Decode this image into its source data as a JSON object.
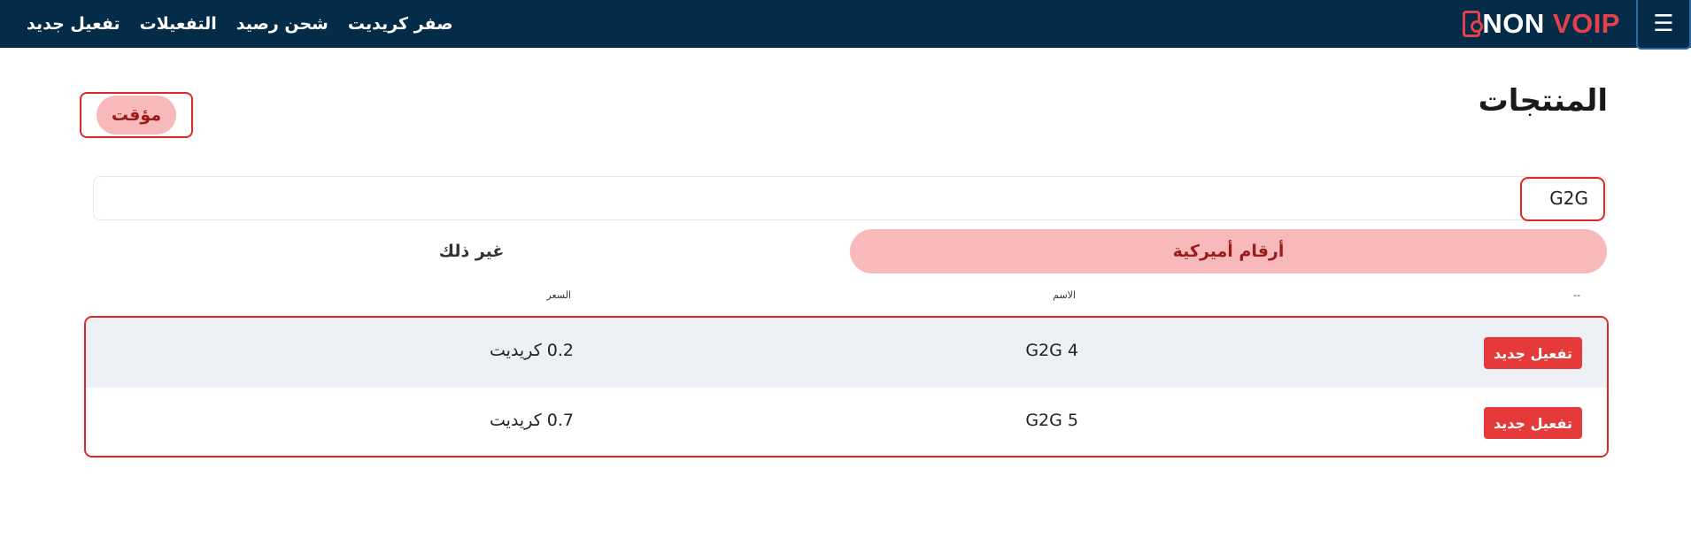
{
  "nav": {
    "links": [
      "تفعيل جديد",
      "التفعيلات",
      "شحن رصيد",
      "صفر كريديت"
    ],
    "logo_part1": "NON",
    "logo_part2": "VOIP",
    "menu_icon": "hamburger-icon",
    "bg_color": "#042b47",
    "accent_color": "#e4424a"
  },
  "header": {
    "title": "المنتجات",
    "timer_label": "مؤقت"
  },
  "search": {
    "value": "G2G",
    "placeholder": ""
  },
  "tabs": [
    {
      "label": "أرقام أميركية",
      "active": true
    },
    {
      "label": "غير ذلك",
      "active": false
    }
  ],
  "table": {
    "columns": [
      "--",
      "الاسم",
      "السعر"
    ],
    "rows": [
      {
        "action": "تفعيل جديد",
        "name": "G2G 4",
        "price": "0.2 كريديت"
      },
      {
        "action": "تفعيل جديد",
        "name": "G2G 5",
        "price": "0.7 كريديت"
      }
    ]
  },
  "colors": {
    "button_red": "#e6393a",
    "pill_pink": "#f7b9b9",
    "highlight_red": "#e02626"
  }
}
